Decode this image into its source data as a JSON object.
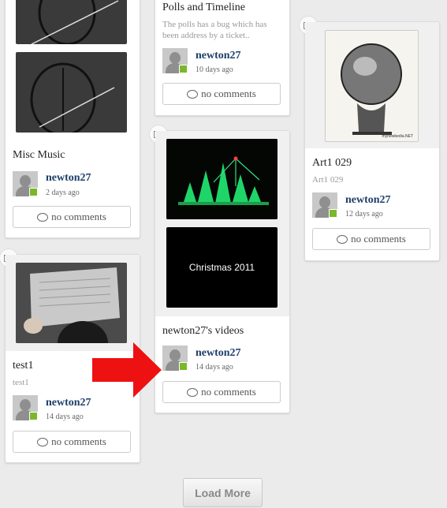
{
  "no_comments_label": "no comments",
  "load_more_label": "Load More",
  "cards": {
    "misc_music": {
      "title": "Misc Music",
      "user": "newton27",
      "ago": "2 days ago"
    },
    "test1": {
      "title": "test1",
      "subtitle": "test1",
      "user": "newton27",
      "ago": "14 days ago"
    },
    "polls": {
      "title": "Polls and Timeline",
      "description": "The polls has a bug which has been address by a ticket..",
      "user": "newton27",
      "ago": "10 days ago"
    },
    "videos": {
      "title": "newton27's videos",
      "video_caption": "Christmas 2011",
      "user": "newton27",
      "ago": "14 days ago"
    },
    "art": {
      "title": "Art1 029",
      "subtitle": "Art1 029",
      "image_caption": "mynewbedia.NET",
      "user": "newton27",
      "ago": "12 days ago"
    }
  },
  "colors": {
    "online": "#7ab82a",
    "username": "#1d3f6a",
    "arrow": "#ee1111"
  }
}
